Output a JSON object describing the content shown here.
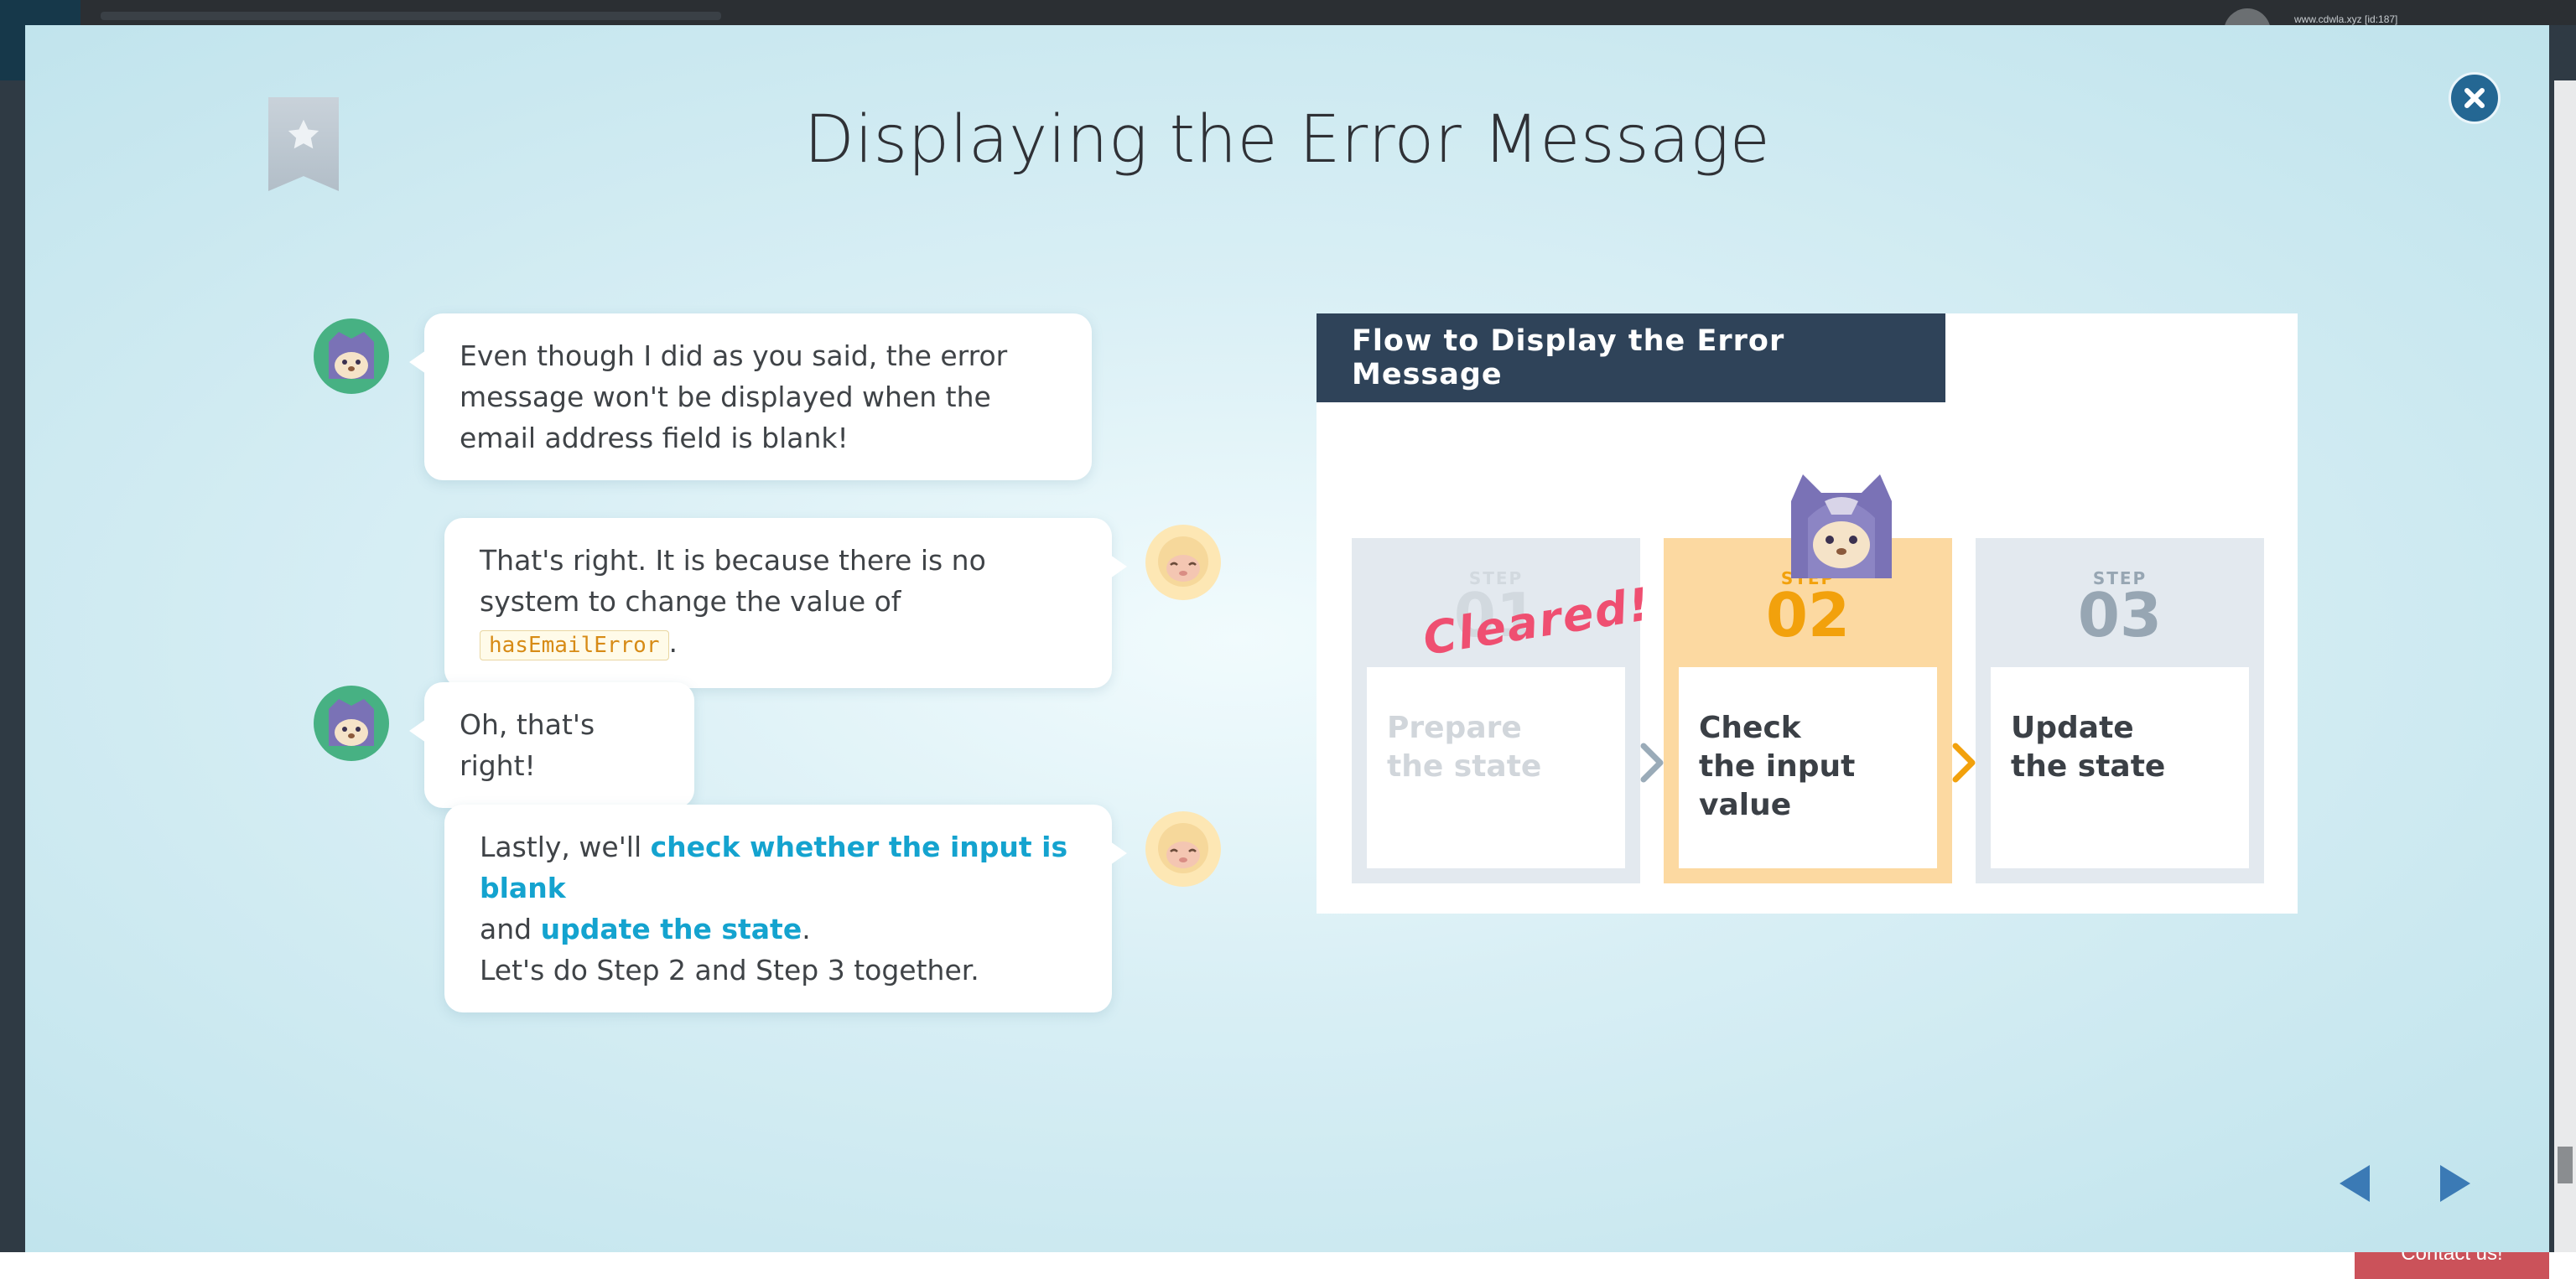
{
  "page": {
    "user_text": "www.cdwla.xyz [id:187]",
    "contact_label": "Contact us!"
  },
  "lesson": {
    "title": "Displaying the Error Message"
  },
  "chat": {
    "msg1": "Even though I did as you said, the error message won't be displayed when the email address field is blank!",
    "msg2_text": "That's right. It is because there is no system to change the value of ",
    "msg2_code": "hasEmailError",
    "msg2_end": ".",
    "msg3": "Oh, that's right!",
    "msg4_a": "Lastly, we'll ",
    "msg4_hl1": "check whether the input is blank",
    "msg4_b": "and ",
    "msg4_hl2": "update the state",
    "msg4_c": ".",
    "msg4_d": "Let's do Step 2 and Step 3 together."
  },
  "flow": {
    "title": "Flow to Display the Error Message",
    "cleared": "Cleared!",
    "steps": [
      {
        "label": "STEP",
        "number": "01",
        "line1": "Prepare",
        "line2": "the state"
      },
      {
        "label": "STEP",
        "number": "02",
        "line1": "Check",
        "line2": "the input value"
      },
      {
        "label": "STEP",
        "number": "03",
        "line1": "Update",
        "line2": "the state"
      }
    ]
  },
  "icons": {
    "bookmark": "star-bookmark-icon",
    "close": "close-icon",
    "prev": "previous-arrow-icon",
    "next": "next-arrow-icon"
  },
  "colors": {
    "accent": "#14a3cf",
    "header_bg": "#2f4359",
    "step_active": "#fcd9a1",
    "step_active_text": "#f2a10c",
    "cleared": "#ef4f71",
    "code": "#d78b16",
    "close_bg": "#246793",
    "nav_arrow": "#3b7ab5"
  }
}
